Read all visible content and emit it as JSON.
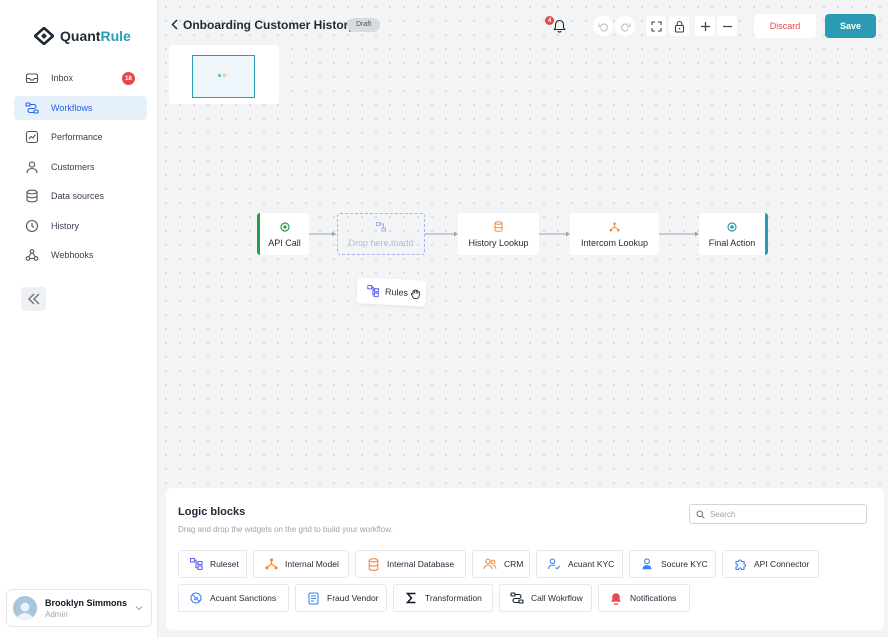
{
  "app": {
    "logo_word": "Quant",
    "logo_accent": "Rule"
  },
  "sidebar": {
    "items": [
      {
        "label": "Inbox",
        "badge": "18"
      },
      {
        "label": "Workflows"
      },
      {
        "label": "Performance"
      },
      {
        "label": "Customers"
      },
      {
        "label": "Data sources"
      },
      {
        "label": "History"
      },
      {
        "label": "Webhooks"
      }
    ],
    "active": "Workflows",
    "user": {
      "name": "Brooklyn Simmons",
      "role": "Admin"
    }
  },
  "header": {
    "title": "Onboarding Customer History",
    "status": "Draft",
    "notifications_count": "4",
    "discard_label": "Discard",
    "save_label": "Save"
  },
  "flow": {
    "nodes": [
      {
        "label": "API Call",
        "icon": "api-icon"
      },
      {
        "label": "Drop here toadd",
        "icon": "ruleset-icon"
      },
      {
        "label": "History Lookup",
        "icon": "database-icon"
      },
      {
        "label": "Intercom Lookup",
        "icon": "branch-icon"
      },
      {
        "label": "Final Action",
        "icon": "target-icon"
      }
    ],
    "dragging": {
      "label": "Rules",
      "icon": "ruleset-icon"
    }
  },
  "logic_blocks": {
    "title": "Logic blocks",
    "subtitle": "Drag and drop the widgets on the grid to build your workflow.",
    "search_placeholder": "Search",
    "row1": [
      {
        "label": "Ruleset",
        "icon": "ruleset-icon"
      },
      {
        "label": "Internal Model",
        "icon": "model-icon"
      },
      {
        "label": "Internal Database",
        "icon": "database-icon"
      },
      {
        "label": "CRM",
        "icon": "crm-icon"
      },
      {
        "label": "Acuant KYC",
        "icon": "user-check-icon"
      },
      {
        "label": "Socure KYC",
        "icon": "user-icon"
      },
      {
        "label": "API Connector",
        "icon": "puzzle-icon"
      }
    ],
    "row2": [
      {
        "label": "Acuant Sanctions",
        "icon": "ban-icon"
      },
      {
        "label": "Fraud Vendor",
        "icon": "document-icon"
      },
      {
        "label": "Transformation",
        "icon": "sigma-icon"
      },
      {
        "label": "Call Wokrflow",
        "icon": "route-icon"
      },
      {
        "label": "Notifications",
        "icon": "bell-icon"
      }
    ]
  },
  "colors": {
    "accent": "#2b9bb5",
    "danger": "#e5484d",
    "success": "#22a04b",
    "active_nav_bg": "#e6f1fb"
  }
}
